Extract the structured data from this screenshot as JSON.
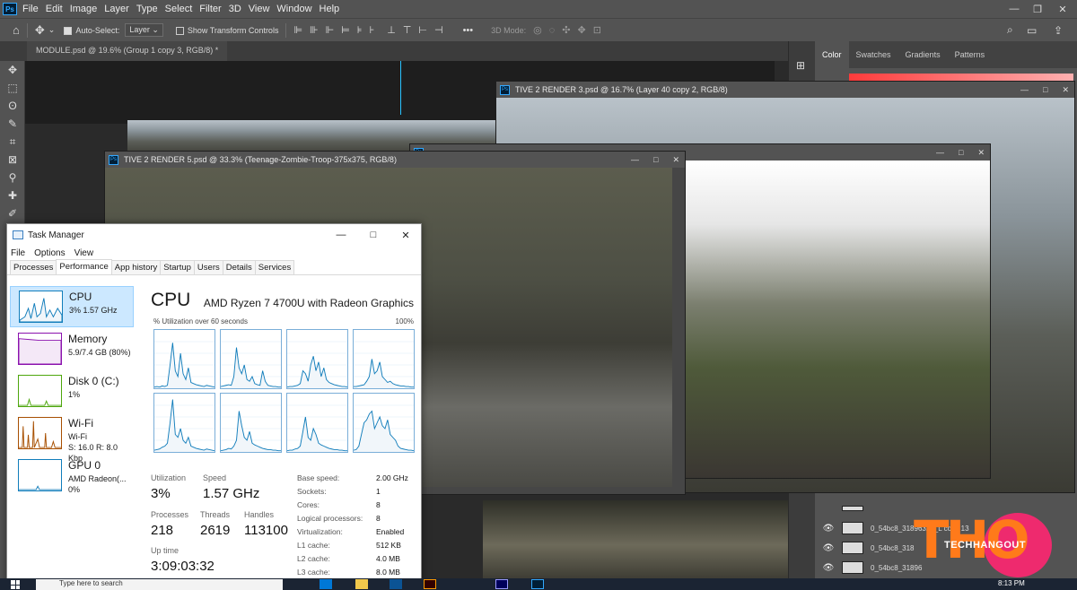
{
  "photoshop": {
    "logo": "Ps",
    "menu": [
      "File",
      "Edit",
      "Image",
      "Layer",
      "Type",
      "Select",
      "Filter",
      "3D",
      "View",
      "Window",
      "Help"
    ],
    "options": {
      "auto_select_label": "Auto-Select:",
      "auto_select_value": "Layer",
      "transform_label": "Show Transform Controls",
      "mode_3d_label": "3D Mode:",
      "more": "•••"
    },
    "doc_tab": "MODULE.psd @ 19.6% (Group 1 copy 3, RGB/8) *",
    "panel_tabs": [
      "Color",
      "Swatches",
      "Gradients",
      "Patterns"
    ],
    "layers": [
      "0_54bc8_31896323_L copy 13",
      "0_54bc8_318",
      "0_54bc8_31896"
    ],
    "windows": [
      {
        "title": "TIVE 2 RENDER 3.psd @ 16.7% (Layer 40 copy 2, RGB/8)"
      },
      {
        "title": "TIVE 2 RENDER 5.psd @ 33.3% (Teenage-Zombie-Troop-375x375, RGB/8)"
      }
    ]
  },
  "task_manager": {
    "title": "Task Manager",
    "menu": [
      "File",
      "Options",
      "View"
    ],
    "tabs": [
      "Processes",
      "Performance",
      "App history",
      "Startup",
      "Users",
      "Details",
      "Services"
    ],
    "sidebar": [
      {
        "name": "CPU",
        "sub1": "3%  1.57 GHz",
        "sub2": "",
        "color": "#117dbb"
      },
      {
        "name": "Memory",
        "sub1": "5.9/7.4 GB (80%)",
        "sub2": "",
        "color": "#8b12ae"
      },
      {
        "name": "Disk 0 (C:)",
        "sub1": "1%",
        "sub2": "",
        "color": "#4da60c"
      },
      {
        "name": "Wi-Fi",
        "sub1": "Wi-Fi",
        "sub2": "S: 16.0  R: 8.0 Kbp",
        "color": "#a74f01"
      },
      {
        "name": "GPU 0",
        "sub1": "AMD Radeon(...",
        "sub2": "0%",
        "color": "#117dbb"
      }
    ],
    "header": "CPU",
    "processor": "AMD Ryzen 7 4700U with Radeon Graphics",
    "util_label": "% Utilization over 60 seconds",
    "util_max": "100%",
    "stats": {
      "utilization_label": "Utilization",
      "utilization": "3%",
      "speed_label": "Speed",
      "speed": "1.57 GHz",
      "processes_label": "Processes",
      "processes": "218",
      "threads_label": "Threads",
      "threads": "2619",
      "handles_label": "Handles",
      "handles": "113100",
      "uptime_label": "Up time",
      "uptime": "3:09:03:32"
    },
    "details": [
      {
        "k": "Base speed:",
        "v": "2.00 GHz"
      },
      {
        "k": "Sockets:",
        "v": "1"
      },
      {
        "k": "Cores:",
        "v": "8"
      },
      {
        "k": "Logical processors:",
        "v": "8"
      },
      {
        "k": "Virtualization:",
        "v": "Enabled"
      },
      {
        "k": "L1 cache:",
        "v": "512 KB"
      },
      {
        "k": "L2 cache:",
        "v": "4.0 MB"
      },
      {
        "k": "L3 cache:",
        "v": "8.0 MB"
      }
    ],
    "core_graphs": [
      [
        2,
        3,
        2,
        4,
        3,
        5,
        40,
        78,
        30,
        20,
        60,
        25,
        15,
        35,
        10,
        8,
        6,
        5,
        4,
        3,
        5,
        4,
        3,
        2
      ],
      [
        3,
        4,
        5,
        6,
        5,
        20,
        70,
        35,
        25,
        40,
        15,
        12,
        20,
        8,
        6,
        5,
        30,
        12,
        5,
        4,
        3,
        3,
        2,
        2
      ],
      [
        2,
        3,
        3,
        4,
        5,
        8,
        30,
        25,
        12,
        40,
        55,
        30,
        45,
        20,
        35,
        15,
        10,
        8,
        6,
        5,
        4,
        3,
        3,
        2
      ],
      [
        3,
        3,
        4,
        5,
        6,
        12,
        20,
        50,
        25,
        30,
        45,
        20,
        15,
        10,
        12,
        8,
        6,
        5,
        4,
        4,
        3,
        3,
        2,
        2
      ],
      [
        3,
        4,
        5,
        8,
        10,
        15,
        50,
        90,
        30,
        25,
        40,
        20,
        15,
        25,
        10,
        8,
        6,
        5,
        4,
        3,
        5,
        4,
        3,
        2
      ],
      [
        2,
        3,
        4,
        6,
        5,
        10,
        20,
        70,
        45,
        25,
        20,
        35,
        15,
        12,
        10,
        8,
        6,
        5,
        4,
        4,
        3,
        3,
        2,
        2
      ],
      [
        2,
        3,
        3,
        5,
        6,
        10,
        35,
        60,
        25,
        20,
        40,
        30,
        15,
        12,
        10,
        8,
        6,
        5,
        4,
        4,
        3,
        3,
        2,
        2
      ],
      [
        3,
        4,
        10,
        30,
        50,
        55,
        65,
        70,
        40,
        50,
        60,
        45,
        40,
        55,
        30,
        25,
        20,
        10,
        6,
        5,
        4,
        3,
        3,
        2
      ]
    ]
  },
  "taskbar": {
    "search_placeholder": "Type here to search",
    "time": "8:13 PM"
  },
  "watermark": {
    "big": "THO",
    "text": "TECHHANGOUT"
  }
}
